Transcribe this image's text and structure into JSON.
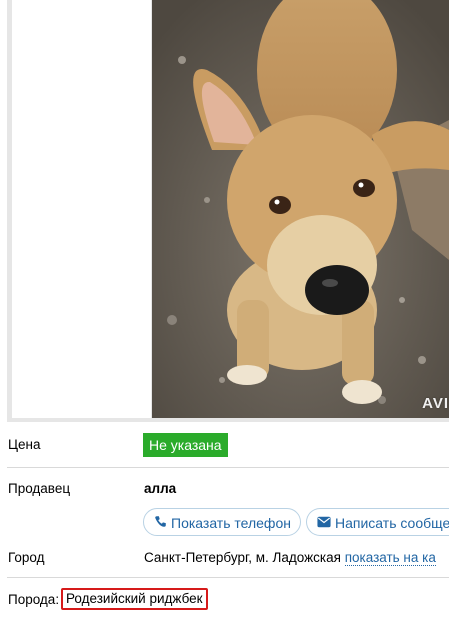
{
  "listing": {
    "photo": {
      "watermark": "AVI",
      "subject": "dog-photo"
    },
    "price": {
      "label": "Цена",
      "value": "Не указана",
      "badge_color": "#2bab2b"
    },
    "seller": {
      "label": "Продавец",
      "name": "алла",
      "show_phone_label": "Показать телефон",
      "write_message_label": "Написать сообще"
    },
    "city": {
      "label": "Город",
      "value": "Санкт-Петербург, м. Ладожская",
      "map_link": "показать на ка"
    },
    "breed": {
      "label": "Порода:",
      "value": "Родезийский риджбек",
      "highlight_color": "#d61a1a"
    }
  },
  "colors": {
    "link": "#2266a4",
    "divider": "#d9d9d9",
    "gallery_border": "#e6e6e6"
  }
}
